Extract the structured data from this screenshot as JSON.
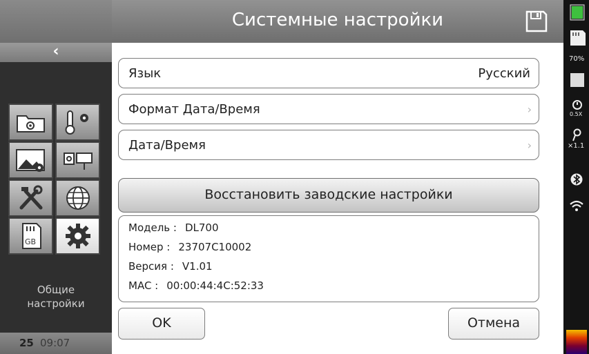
{
  "header": {
    "title": "Системные настройки"
  },
  "sidebar": {
    "back": "‹",
    "label_line1": "Общие",
    "label_line2": "настройки",
    "date": "25",
    "time": "09:07",
    "sd_label": "GB"
  },
  "settings": {
    "language_label": "Язык",
    "language_value": "Русский",
    "datetime_format_label": "Формат Дата/Время",
    "datetime_label": "Дата/Время",
    "reset_label": "Восстановить заводские настройки"
  },
  "device_info": {
    "model_label": "Модель :",
    "model_value": "DL700",
    "number_label": "Номер :",
    "number_value": "23707C10002",
    "version_label": "Версия :",
    "version_value": "V1.01",
    "mac_label": "MAC :",
    "mac_value": "00:00:44:4C:52:33"
  },
  "buttons": {
    "ok": "OK",
    "cancel": "Отмена"
  },
  "status": {
    "battery": "70%",
    "zoom": "0.5X",
    "lens": "×1.1"
  },
  "colors": {
    "header": "#7d7d7d",
    "sidebar": "#2f2f2f",
    "accent_palette": "#f0b000"
  }
}
